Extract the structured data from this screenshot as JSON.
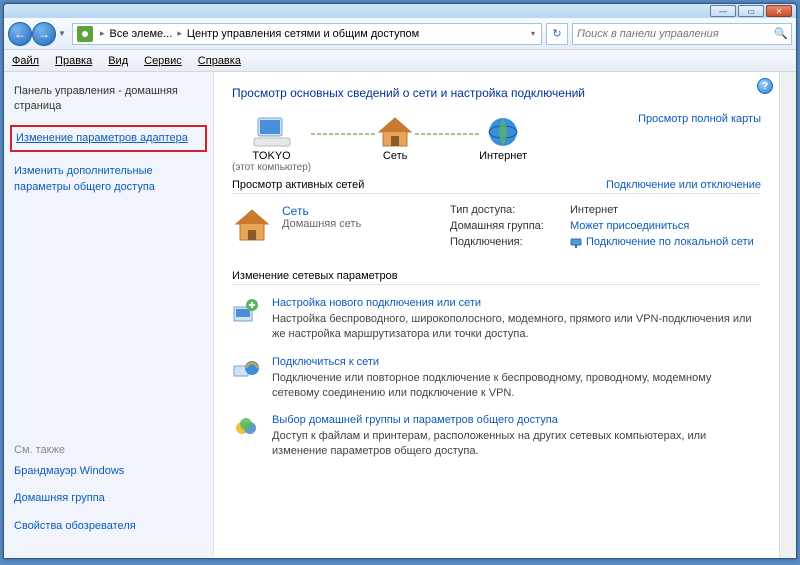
{
  "titlebar": {
    "min": "—",
    "max": "▭",
    "close": "✕"
  },
  "nav": {
    "back": "←",
    "forward": "→",
    "dropdown": "▼",
    "segment1": "Все элеме...",
    "segment2": "Центр управления сетями и общим доступом",
    "refresh": "↻",
    "search_placeholder": "Поиск в панели управления"
  },
  "menu": {
    "file": "Файл",
    "edit": "Правка",
    "view": "Вид",
    "tools": "Сервис",
    "help": "Справка"
  },
  "sidebar": {
    "home": "Панель управления - домашняя страница",
    "adapter": "Изменение параметров адаптера",
    "sharing": "Изменить дополнительные параметры общего доступа",
    "also": "См. также",
    "l1": "Брандмауэр Windows",
    "l2": "Домашняя группа",
    "l3": "Свойства обозревателя"
  },
  "main": {
    "heading": "Просмотр основных сведений о сети и настройка подключений",
    "map": {
      "n1": "TOKYO",
      "n1sub": "(этот компьютер)",
      "n2": "Сеть",
      "n3": "Интернет",
      "full": "Просмотр полной карты"
    },
    "active": {
      "hdr": "Просмотр активных сетей",
      "hdrlink": "Подключение или отключение",
      "name": "Сеть",
      "type": "Домашняя сеть",
      "r1l": "Тип доступа:",
      "r1v": "Интернет",
      "r2l": "Домашняя группа:",
      "r2v": "Может присоединиться",
      "r3l": "Подключения:",
      "r3v": "Подключение по локальной сети"
    },
    "settings": {
      "hdr": "Изменение сетевых параметров",
      "t1": "Настройка нового подключения или сети",
      "t1d": "Настройка беспроводного, широкополосного, модемного, прямого или VPN-подключения или же настройка маршрутизатора или точки доступа.",
      "t2": "Подключиться к сети",
      "t2d": "Подключение или повторное подключение к беспроводному, проводному, модемному сетевому соединению или подключение к VPN.",
      "t3": "Выбор домашней группы и параметров общего доступа",
      "t3d": "Доступ к файлам и принтерам, расположенных на других сетевых компьютерах, или изменение параметров общего доступа."
    }
  },
  "help": "?"
}
